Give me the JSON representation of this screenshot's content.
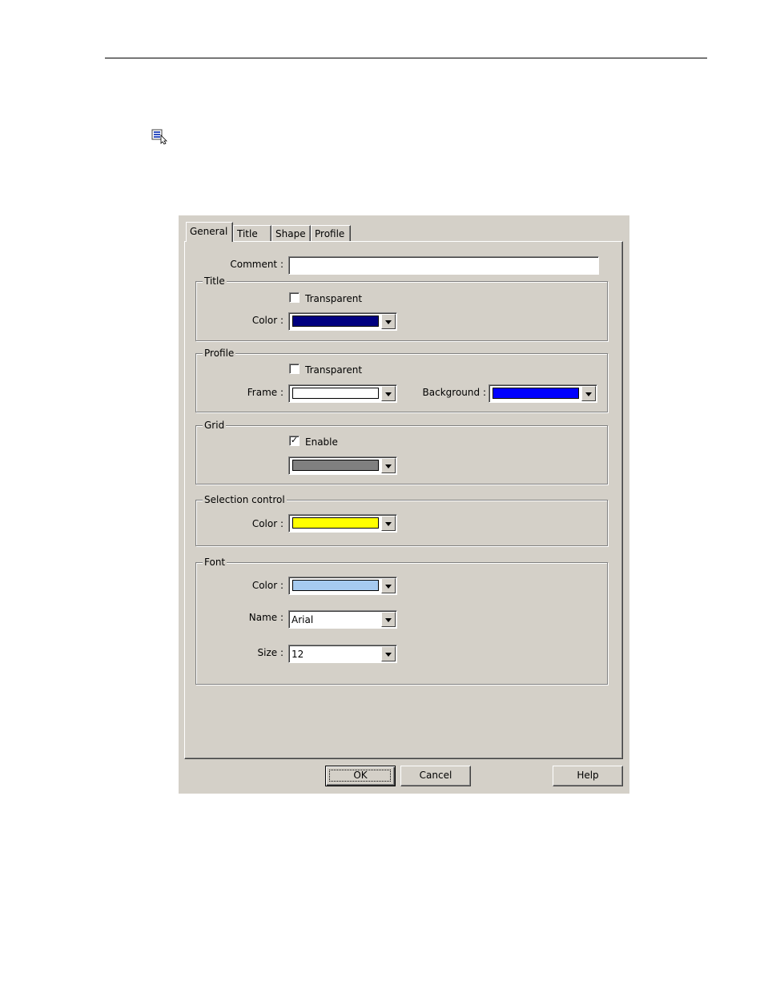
{
  "tabs": [
    "General",
    "Title",
    "Shape",
    "Profile"
  ],
  "comment": {
    "label": "Comment :",
    "value": ""
  },
  "title_group": {
    "title": "Title",
    "transparent_label": "Transparent",
    "transparent_checked": false,
    "color_label": "Color :",
    "color": "#000080"
  },
  "profile_group": {
    "title": "Profile",
    "transparent_label": "Transparent",
    "transparent_checked": false,
    "frame_label": "Frame :",
    "frame_color": "#ffffff",
    "background_label": "Background :",
    "background_color": "#0000ff"
  },
  "grid_group": {
    "title": "Grid",
    "enable_label": "Enable",
    "enable_checked": true,
    "color": "#808080",
    "check_mark": "✓"
  },
  "selection_group": {
    "title": "Selection control",
    "color_label": "Color :",
    "color": "#ffff00"
  },
  "font_group": {
    "title": "Font",
    "color_label": "Color :",
    "color": "#a6caf0",
    "name_label": "Name :",
    "name_value": "Arial",
    "size_label": "Size :",
    "size_value": "12"
  },
  "buttons": {
    "ok": "OK",
    "cancel": "Cancel",
    "help": "Help"
  }
}
